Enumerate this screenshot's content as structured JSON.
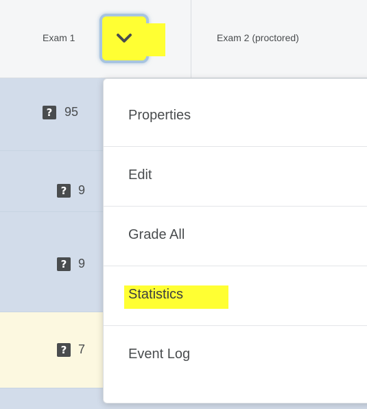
{
  "header": {
    "col1_label": "Exam 1",
    "col2_label": "Exam 2 (proctored)"
  },
  "rows": [
    {
      "grade": "95",
      "highlight": false
    },
    {
      "grade": "9",
      "highlight": false
    },
    {
      "grade": "9",
      "highlight": false
    },
    {
      "grade": "7",
      "highlight": true
    }
  ],
  "menu": {
    "items": [
      {
        "label": "Properties"
      },
      {
        "label": "Edit"
      },
      {
        "label": "Grade All"
      },
      {
        "label": "Statistics"
      },
      {
        "label": "Event Log"
      }
    ]
  },
  "colors": {
    "highlight": "#ffff33",
    "row_blue": "#d2dcea",
    "row_yellow": "#fcf8e0"
  },
  "icons": [
    "chevron-down-icon",
    "question-icon"
  ]
}
